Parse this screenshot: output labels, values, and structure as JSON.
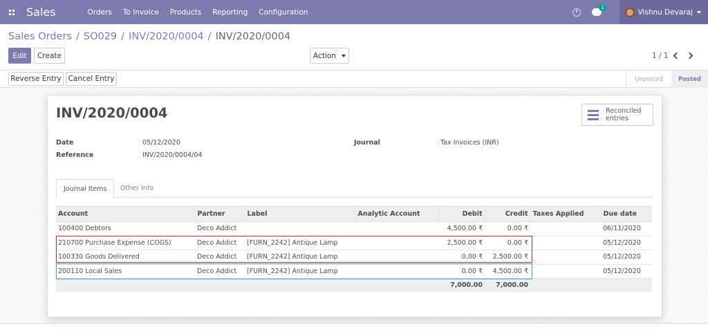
{
  "navbar": {
    "apps_icon": "apps-grid-icon",
    "brand": "Sales",
    "menu": [
      "Orders",
      "To Invoice",
      "Products",
      "Reporting",
      "Configuration"
    ],
    "chat_badge": "1",
    "user_name": "Vishnu Devaraj",
    "bg_color": "#7c7bad"
  },
  "breadcrumb": {
    "items": [
      "Sales Orders",
      "SO029",
      "INV/2020/0004"
    ],
    "current": "INV/2020/0004"
  },
  "toolbar": {
    "edit_label": "Edit",
    "create_label": "Create",
    "action_label": "Action",
    "pager": "1 / 1"
  },
  "statusbar": {
    "reverse_label": "Reverse Entry",
    "cancel_label": "Cancel Entry",
    "stages": [
      "Unposted",
      "Posted"
    ],
    "current_stage": "Posted"
  },
  "form": {
    "title": "INV/2020/0004",
    "smart_button_label": "Reconciled entries",
    "fields": {
      "date_label": "Date",
      "date_value": "05/12/2020",
      "reference_label": "Reference",
      "reference_value": "INV/2020/0004/04",
      "journal_label": "Journal",
      "journal_value": "Tax Invoices (INR)"
    },
    "tabs": [
      "Journal Items",
      "Other Info"
    ],
    "active_tab": "Journal Items",
    "table": {
      "columns": [
        "Account",
        "Partner",
        "Label",
        "Analytic Account",
        "Debit",
        "Credit",
        "Taxes Applied",
        "Due date"
      ],
      "rows": [
        [
          "100400 Debtors",
          "Deco Addict",
          "",
          "",
          "4,500.00 ₹",
          "0.00 ₹",
          "",
          "06/11/2020"
        ],
        [
          "210700 Purchase Expense (COGS)",
          "Deco Addict",
          "[FURN_2242] Antique Lamp",
          "",
          "2,500.00 ₹",
          "0.00 ₹",
          "",
          "05/12/2020"
        ],
        [
          "100330 Goods Delivered",
          "Deco Addict",
          "[FURN_2242] Antique Lamp",
          "",
          "0.00 ₹",
          "2,500.00 ₹",
          "",
          "05/12/2020"
        ],
        [
          "200110 Local Sales",
          "Deco Addict",
          "[FURN_2242] Antique Lamp",
          "",
          "0.00 ₹",
          "4,500.00 ₹",
          "",
          "05/12/2020"
        ]
      ],
      "totals": {
        "debit": "7,000.00",
        "credit": "7,000.00"
      }
    }
  },
  "highlight_colors": {
    "red": "#e02020",
    "blue": "#29a8e0"
  }
}
